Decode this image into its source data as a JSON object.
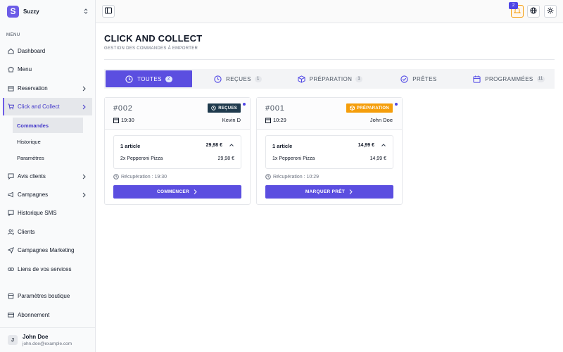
{
  "brand": {
    "logo_letter": "S",
    "name": "Suzzy"
  },
  "sidebar": {
    "menu_label": "MENU",
    "items": [
      {
        "label": "Dashboard",
        "icon": "home-icon"
      },
      {
        "label": "Menu",
        "icon": "chef-hat-icon"
      },
      {
        "label": "Reservation",
        "icon": "calendar-icon",
        "has_chevron": true
      },
      {
        "label": "Click and Collect",
        "icon": "cart-icon",
        "has_chevron": true,
        "active": true
      },
      {
        "label": "Avis clients",
        "icon": "message-icon",
        "has_chevron": true
      },
      {
        "label": "Campagnes",
        "icon": "megaphone-icon",
        "has_chevron": true
      },
      {
        "label": "Historique SMS",
        "icon": "chat-icon"
      },
      {
        "label": "Clients",
        "icon": "users-icon"
      },
      {
        "label": "Campagnes Marketing",
        "icon": "send-icon"
      },
      {
        "label": "Liens de vos services",
        "icon": "link-icon"
      },
      {
        "label": "Paramètres boutique",
        "icon": "store-icon"
      },
      {
        "label": "Abonnement",
        "icon": "credit-card-icon"
      }
    ],
    "subitems": [
      {
        "label": "Commandes",
        "active": true
      },
      {
        "label": "Historique"
      },
      {
        "label": "Paramètres"
      }
    ],
    "user": {
      "initial": "J",
      "name": "John Doe",
      "email": "john.doe@example.com"
    }
  },
  "header": {
    "notification_count": "2"
  },
  "page": {
    "title": "CLICK AND COLLECT",
    "subtitle": "GESTION DES COMMANDES À EMPORTER"
  },
  "tabs": [
    {
      "label": "TOUTES",
      "count": "2",
      "active": true,
      "icon": "clock-icon"
    },
    {
      "label": "REÇUES",
      "count": "1",
      "icon": "clock-icon"
    },
    {
      "label": "PRÉPARATION",
      "count": "1",
      "icon": "package-icon"
    },
    {
      "label": "PRÊTES",
      "count": "",
      "icon": "check-circle-icon"
    },
    {
      "label": "PROGRAMMÉES",
      "count": "11",
      "icon": "calendar-icon"
    }
  ],
  "orders": [
    {
      "number": "#002",
      "status": "REÇUES",
      "status_color": "#1f3a4d",
      "time": "19:30",
      "customer": "Kevin D",
      "items_count": "1 article",
      "total": "29,98 €",
      "line": "2x Pepperoni Pizza",
      "line_price": "29,98 €",
      "pickup": "Récupération : 19:30",
      "action": "COMMENCER"
    },
    {
      "number": "#001",
      "status": "PRÉPARATION",
      "status_color": "#f59e0b",
      "time": "10:29",
      "customer": "John Doe",
      "items_count": "1 article",
      "total": "14,99 €",
      "line": "1x Pepperoni Pizza",
      "line_price": "14,99 €",
      "pickup": "Récupération : 10:29",
      "action": "MARQUER PRÊT"
    }
  ],
  "colors": {
    "accent": "#5b4ee0",
    "brand": "#6c5ce7"
  }
}
